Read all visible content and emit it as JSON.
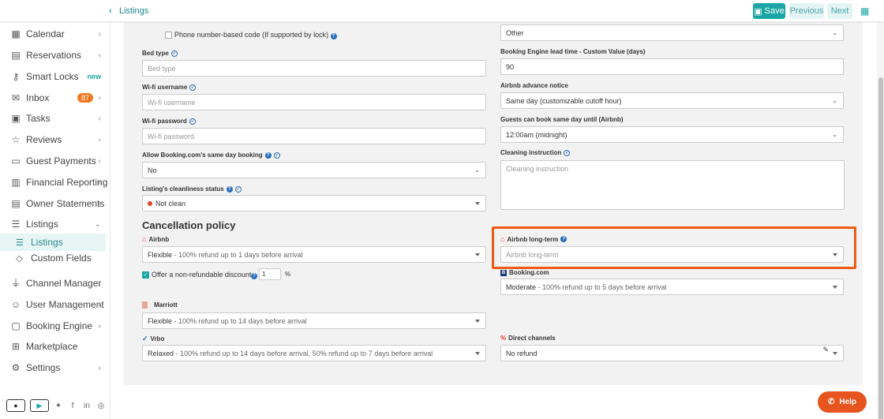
{
  "topbar": {
    "breadcrumb": "Listings",
    "save_label": "Save",
    "previous_label": "Previous",
    "next_label": "Next"
  },
  "sidebar": {
    "items": [
      {
        "label": "Calendar",
        "icon": "calendar-icon"
      },
      {
        "label": "Reservations",
        "icon": "reservations-icon"
      },
      {
        "label": "Smart Locks",
        "icon": "key-icon",
        "badge": "new"
      },
      {
        "label": "Inbox",
        "icon": "inbox-icon",
        "count": "87"
      },
      {
        "label": "Tasks",
        "icon": "tasks-icon"
      },
      {
        "label": "Reviews",
        "icon": "star-icon"
      },
      {
        "label": "Guest Payments",
        "icon": "card-icon"
      },
      {
        "label": "Financial Reporting",
        "icon": "report-icon"
      },
      {
        "label": "Owner Statements",
        "icon": "statement-icon"
      },
      {
        "label": "Listings",
        "icon": "list-icon"
      },
      {
        "label": "Listings",
        "icon": "list-icon"
      },
      {
        "label": "Custom Fields",
        "icon": "tag-icon"
      },
      {
        "label": "Channel Manager",
        "icon": "plug-icon"
      },
      {
        "label": "User Management",
        "icon": "user-icon"
      },
      {
        "label": "Booking Engine",
        "icon": "booking-icon"
      },
      {
        "label": "Marketplace",
        "icon": "marketplace-icon"
      },
      {
        "label": "Settings",
        "icon": "gear-icon"
      }
    ]
  },
  "left_col": {
    "phone_code_label": "Phone number-based code (If supported by lock)",
    "bed_type_label": "Bed type",
    "bed_type_placeholder": "Bed type",
    "wifi_username_label": "Wi-fi username",
    "wifi_username_placeholder": "Wi-fi username",
    "wifi_password_label": "Wi-fi password",
    "wifi_password_placeholder": "Wi-fi password",
    "same_day_label": "Allow Booking.com's same day booking",
    "same_day_value": "No",
    "cleanliness_label": "Listing's cleanliness status",
    "cleanliness_value": "Not clean"
  },
  "right_col": {
    "other_value": "Other",
    "lead_time_label": "Booking Engine lead time - Custom Value (days)",
    "lead_time_value": "90",
    "advance_notice_label": "Airbnb advance notice",
    "advance_notice_value": "Same day (customizable cutoff hour)",
    "same_day_until_label": "Guests can book same day until (Airbnb)",
    "same_day_until_value": "12:00am (midnight)",
    "cleaning_instruction_label": "Cleaning instruction",
    "cleaning_instruction_placeholder": "Cleaning instruction"
  },
  "cancellation": {
    "title": "Cancellation policy",
    "airbnb_label": "Airbnb",
    "airbnb_value_strong": "Flexible",
    "airbnb_value_rest": " - 100% refund up to 1 days before arrival",
    "non_refundable_label": "Offer a non-refundable discount",
    "non_refundable_value": "1",
    "percent": "%",
    "airbnb_long_label": "Airbnb long-term",
    "airbnb_long_placeholder": "Airbnb long-term",
    "booking_label": "Booking.com",
    "booking_value_strong": "Moderate",
    "booking_value_rest": " - 100% refund up to 5 days before arrival",
    "marriott_label": "Marriott",
    "marriott_value_strong": "Flexible",
    "marriott_value_rest": " - 100% refund up to 14 days before arrival",
    "vrbo_label": "Vrbo",
    "vrbo_value_strong": "Relaxed",
    "vrbo_value_rest": " - 100% refund up to 14 days before arrival, 50% refund up to 7 days before arrival",
    "direct_label": "Direct channels",
    "direct_value": "No refund"
  },
  "help_label": "Help",
  "colors": {
    "accent": "#1aa6a6",
    "highlight": "#f05a14",
    "help": "#e8541e"
  }
}
